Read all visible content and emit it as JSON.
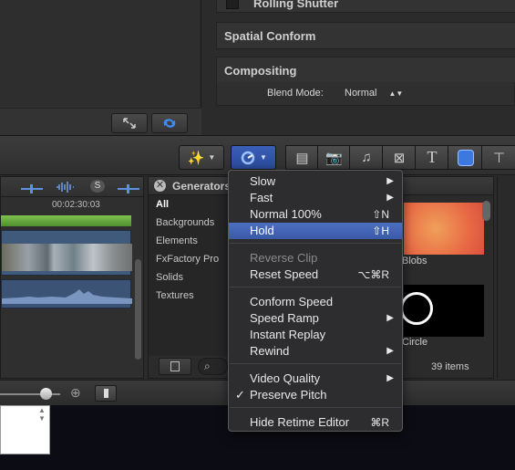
{
  "inspector": {
    "rolling_shutter": "Rolling Shutter",
    "spatial_conform": "Spatial Conform",
    "compositing": "Compositing",
    "blend_mode_label": "Blend Mode:",
    "blend_mode_value": "Normal"
  },
  "timeline": {
    "timecode": "00:02:30:03"
  },
  "browser": {
    "title": "Generators",
    "categories": [
      "All",
      "Backgrounds",
      "Elements",
      "FxFactory Pro",
      "Solids",
      "Textures"
    ],
    "items": [
      {
        "label": "Blobs"
      },
      {
        "label": "Circle"
      }
    ],
    "count": "39 items"
  },
  "menu": {
    "items": [
      {
        "label": "Slow",
        "shortcut": "",
        "submenu": true
      },
      {
        "label": "Fast",
        "shortcut": "",
        "submenu": true
      },
      {
        "label": "Normal 100%",
        "shortcut": "⇧N"
      },
      {
        "label": "Hold",
        "shortcut": "⇧H",
        "selected": true
      },
      {
        "label": "Reverse Clip",
        "shortcut": "",
        "disabled": true
      },
      {
        "label": "Reset Speed",
        "shortcut": "⌥⌘R"
      },
      {
        "label": "Conform Speed",
        "shortcut": ""
      },
      {
        "label": "Speed Ramp",
        "shortcut": "",
        "submenu": true
      },
      {
        "label": "Instant Replay",
        "shortcut": ""
      },
      {
        "label": "Rewind",
        "shortcut": "",
        "submenu": true
      },
      {
        "label": "Video Quality",
        "shortcut": "",
        "submenu": true
      },
      {
        "label": "Preserve Pitch",
        "shortcut": "",
        "checked": true
      },
      {
        "label": "Hide Retime Editor",
        "shortcut": "⌘R"
      }
    ],
    "check_mark": "✓",
    "submenu_arrow": "▶"
  },
  "colors": {
    "selection": "#3f60b0",
    "accent_blue": "#2d6fe0",
    "green_track": "#5aa03a"
  }
}
